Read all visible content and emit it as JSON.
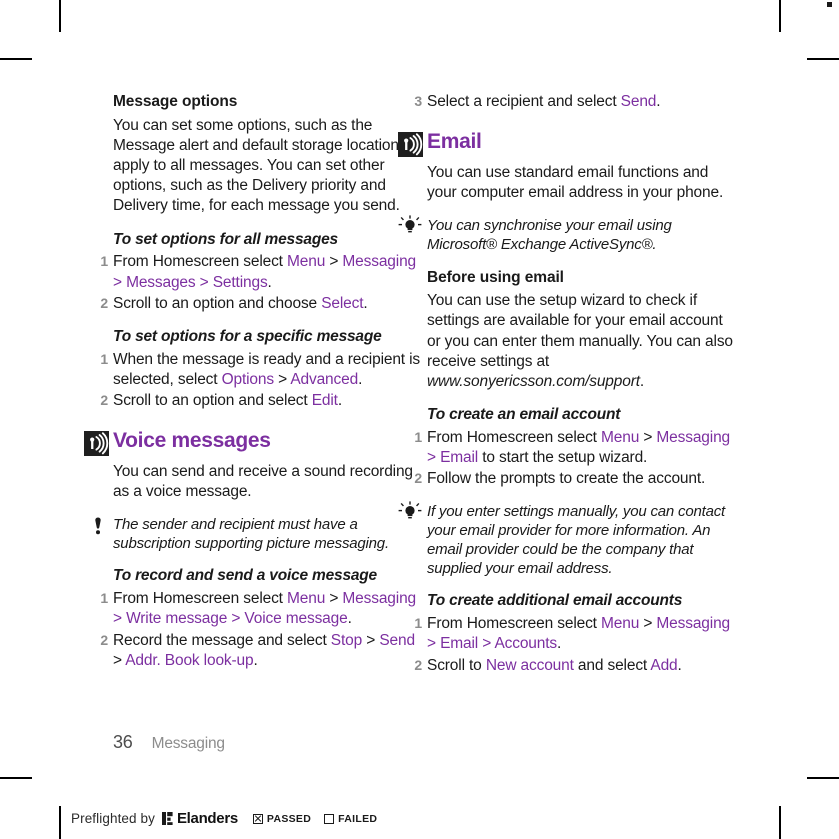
{
  "document": {
    "folio": "36",
    "chapter": "Messaging"
  },
  "left_column": {
    "message_options": {
      "heading": "Message options",
      "body": "You can set some options, such as the Message alert and default storage location, to apply to all messages. You can set other options, such as the Delivery priority and Delivery time, for each message you send."
    },
    "task_all_messages": {
      "heading": "To set options for all messages",
      "step1": {
        "a": "From Homescreen select ",
        "menu": "Menu",
        "b": " > ",
        "messaging": "Messaging",
        "c": " > ",
        "messages": "Messages",
        "d": " > ",
        "settings": "Settings",
        "e": "."
      },
      "step2": {
        "a": "Scroll to an option and choose ",
        "select": "Select",
        "b": "."
      }
    },
    "task_specific_message": {
      "heading": "To set options for a specific message",
      "step1": {
        "a": "When the message is ready and a recipient is selected, select ",
        "options": "Options",
        "b": " > ",
        "advanced": "Advanced",
        "c": "."
      },
      "step2": {
        "a": "Scroll to an option and select ",
        "edit": "Edit",
        "b": "."
      }
    },
    "voice_messages": {
      "icon": "broadcast-icon",
      "title": "Voice messages",
      "body": "You can send and receive a sound recording as a voice message.",
      "note": {
        "icon": "note-exclamation-icon",
        "text": "The sender and recipient must have a subscription supporting picture messaging."
      }
    },
    "task_record_voice": {
      "heading": "To record and send a voice message",
      "step1": {
        "a": "From Homescreen select ",
        "menu": "Menu",
        "b": " > ",
        "messaging": "Messaging",
        "c": " > ",
        "write_message": "Write message",
        "d": " > ",
        "voice_message": "Voice message",
        "e": "."
      },
      "step2": {
        "a": "Record the message and select ",
        "stop": "Stop",
        "b": " > ",
        "send": "Send",
        "c": " > ",
        "addr_book": "Addr. Book look-up",
        "d": "."
      }
    }
  },
  "right_column": {
    "orphan_step": {
      "number": "3",
      "a": "Select a recipient and select ",
      "send": "Send",
      "b": "."
    },
    "email": {
      "icon": "broadcast-icon",
      "title": "Email",
      "body": "You can use standard email functions and your computer email address in your phone.",
      "tip": {
        "icon": "lightbulb-tip-icon",
        "text": "You can synchronise your email using Microsoft® Exchange ActiveSync®."
      }
    },
    "before_using_email": {
      "heading": "Before using email",
      "body_a": "You can use the setup wizard to check if settings are available for your email account or you can enter them manually. You can also receive settings at ",
      "url": "www.sonyericsson.com/support",
      "body_b": "."
    },
    "task_create_account": {
      "heading": "To create an email account",
      "step1": {
        "a": "From Homescreen select ",
        "menu": "Menu",
        "b": " > ",
        "messaging": "Messaging",
        "c": " > ",
        "email": "Email",
        "d": " to start the setup wizard."
      },
      "step2": {
        "a": "Follow the prompts to create the account."
      },
      "tip": {
        "icon": "lightbulb-tip-icon",
        "text": "If you enter settings manually, you can contact your email provider for more information. An email provider could be the company that supplied your email address."
      }
    },
    "task_additional_accounts": {
      "heading": "To create additional email accounts",
      "step1": {
        "a": "From Homescreen select ",
        "menu": "Menu",
        "b": " > ",
        "messaging": "Messaging",
        "c": " > ",
        "email": "Email",
        "d": " > ",
        "accounts": "Accounts",
        "e": "."
      },
      "step2": {
        "a": "Scroll to ",
        "new_account": "New account",
        "b": " and select ",
        "add": "Add",
        "c": "."
      }
    }
  },
  "preflight": {
    "label": "Preflighted by",
    "brand": "Elanders",
    "passed_label": "PASSED",
    "failed_label": "FAILED",
    "passed_checked": true,
    "failed_checked": false
  },
  "colors": {
    "accent_purple": "#7c2fa0",
    "body_text": "#1a1a1a",
    "muted": "#8c8c8c"
  }
}
